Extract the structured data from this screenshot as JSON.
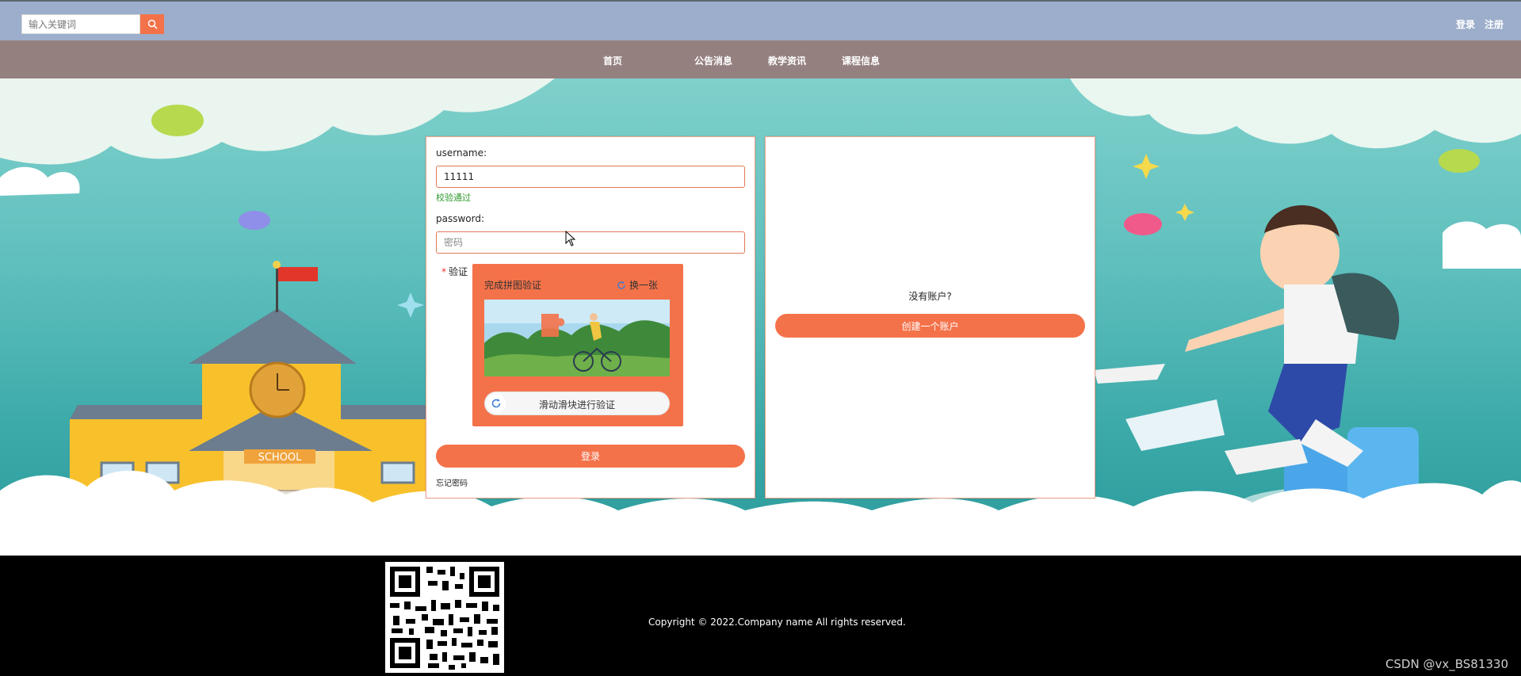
{
  "header": {
    "search_placeholder": "输入关键词",
    "search_icon": "search-icon",
    "login_link": "登录",
    "register_link": "注册"
  },
  "nav": {
    "items": [
      {
        "label": "首页"
      },
      {
        "label": "公告消息"
      },
      {
        "label": "教学资讯"
      },
      {
        "label": "课程信息"
      }
    ]
  },
  "login_form": {
    "username_label": "username:",
    "username_value": "11111",
    "username_status": "校验通过",
    "password_label": "password:",
    "password_placeholder": "密码",
    "captcha_label": "验证",
    "captcha": {
      "title": "完成拼图验证",
      "refresh_label": "换一张",
      "slider_text": "滑动滑块进行验证"
    },
    "login_button": "登录",
    "forgot_link": "忘记密码"
  },
  "register_panel": {
    "prompt": "没有账户?",
    "create_button": "创建一个账户"
  },
  "hero": {
    "school_sign": "SCHOOL"
  },
  "footer": {
    "copyright": "Copyright © 2022.Company name All rights reserved.",
    "watermark": "CSDN @vx_BS81330"
  },
  "colors": {
    "accent": "#f4724a",
    "topbar": "#9caecb",
    "navbar": "#958080",
    "success": "#2e9a2e"
  }
}
